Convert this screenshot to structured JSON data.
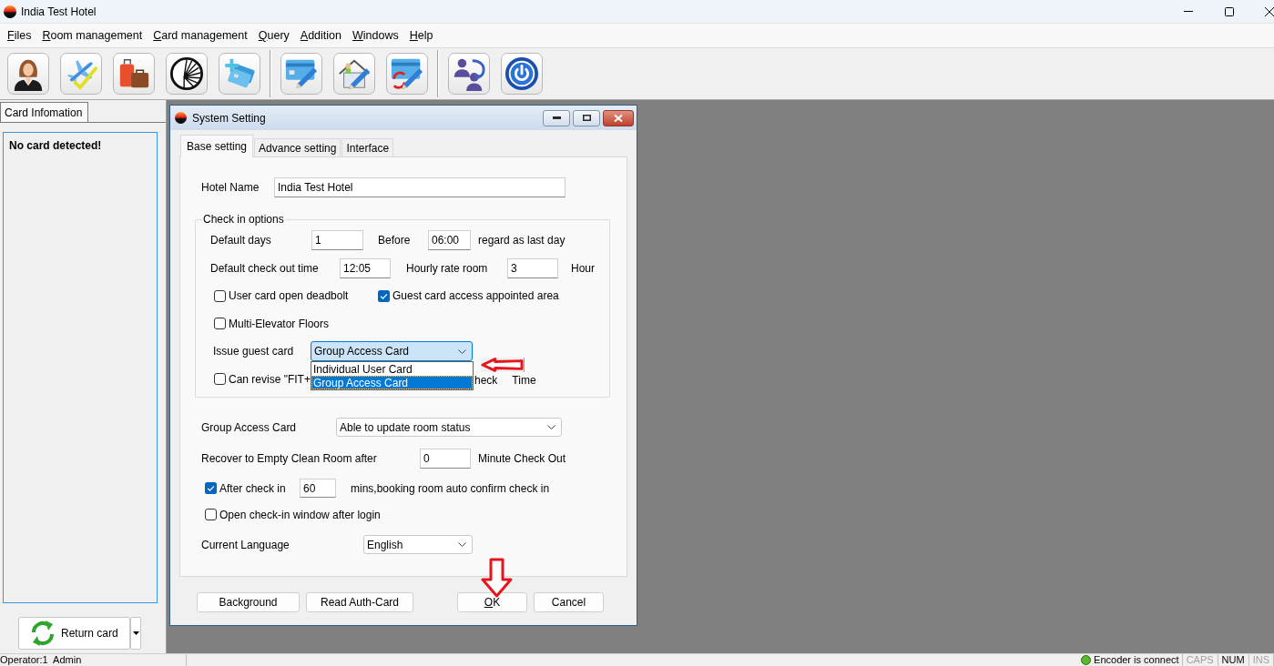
{
  "window": {
    "title": "India Test Hotel"
  },
  "menu": [
    "Files",
    "Room management",
    "Card management",
    "Query",
    "Addition",
    "Windows",
    "Help"
  ],
  "side_panel": {
    "tab": "Card Infomation",
    "message": "No card detected!",
    "return_button": "Return card"
  },
  "dialog": {
    "title": "System Setting",
    "tabs": [
      {
        "label": "Base setting",
        "selected": true
      },
      {
        "label": "Advance setting",
        "selected": false
      },
      {
        "label": "Interface",
        "selected": false
      }
    ],
    "hotel_name": {
      "label": "Hotel Name",
      "value": "India Test Hotel"
    },
    "check_in_options": {
      "legend": "Check in options",
      "default_days": {
        "label": "Default days",
        "value": "1"
      },
      "before": {
        "label": "Before",
        "value": "06:00",
        "suffix": "regard as last day"
      },
      "check_out_time": {
        "label": "Default check out time",
        "value": "12:05"
      },
      "hourly_rate_room": {
        "label": "Hourly rate room",
        "value": "3",
        "suffix": "Hour"
      },
      "options": [
        {
          "label": "User card open deadbolt",
          "checked": false
        },
        {
          "label": "Guest card access appointed area",
          "checked": true
        }
      ],
      "multi_elevator": {
        "label": "Multi-Elevator Floors",
        "checked": false
      },
      "issue_guest_card": {
        "label": "Issue guest card",
        "value": "Group Access Card",
        "focused": true,
        "expanded": true,
        "list": [
          {
            "label": "Individual User Card",
            "selected": false
          },
          {
            "label": "Group Access Card",
            "selected": true
          }
        ]
      },
      "can_revise": {
        "label": "Can revise \"FIT+",
        "checked": false,
        "tail": [
          "heck",
          "Time"
        ]
      }
    },
    "group_access_card": {
      "label": "Group Access Card",
      "value": "Able to update room status"
    },
    "recover": {
      "label": "Recover to Empty Clean Room after",
      "value": "0",
      "suffix": "Minute Check Out"
    },
    "auto_confirm": {
      "label": "After check in",
      "checked": true,
      "value": "60",
      "suffix": "mins,booking room auto confirm check in"
    },
    "open_check_in": {
      "label": "Open check-in window after login",
      "checked": false
    },
    "language": {
      "label": "Current Language",
      "value": "English"
    },
    "buttons": [
      {
        "label": "Background",
        "mnemonic": false
      },
      {
        "label": "Read Auth-Card",
        "mnemonic": false
      },
      {
        "label": "OK",
        "mnemonic": true
      },
      {
        "label": "Cancel",
        "mnemonic": false
      }
    ]
  },
  "annotations": [
    {
      "kind": "left-arrow"
    },
    {
      "kind": "down-arrow"
    }
  ],
  "status_bar": {
    "operator": "Operator:1  Admin",
    "encoder": "Encoder is connect",
    "indicators": [
      {
        "label": "CAPS",
        "on": false
      },
      {
        "label": "NUM",
        "on": true
      },
      {
        "label": "INS",
        "on": false
      }
    ]
  }
}
